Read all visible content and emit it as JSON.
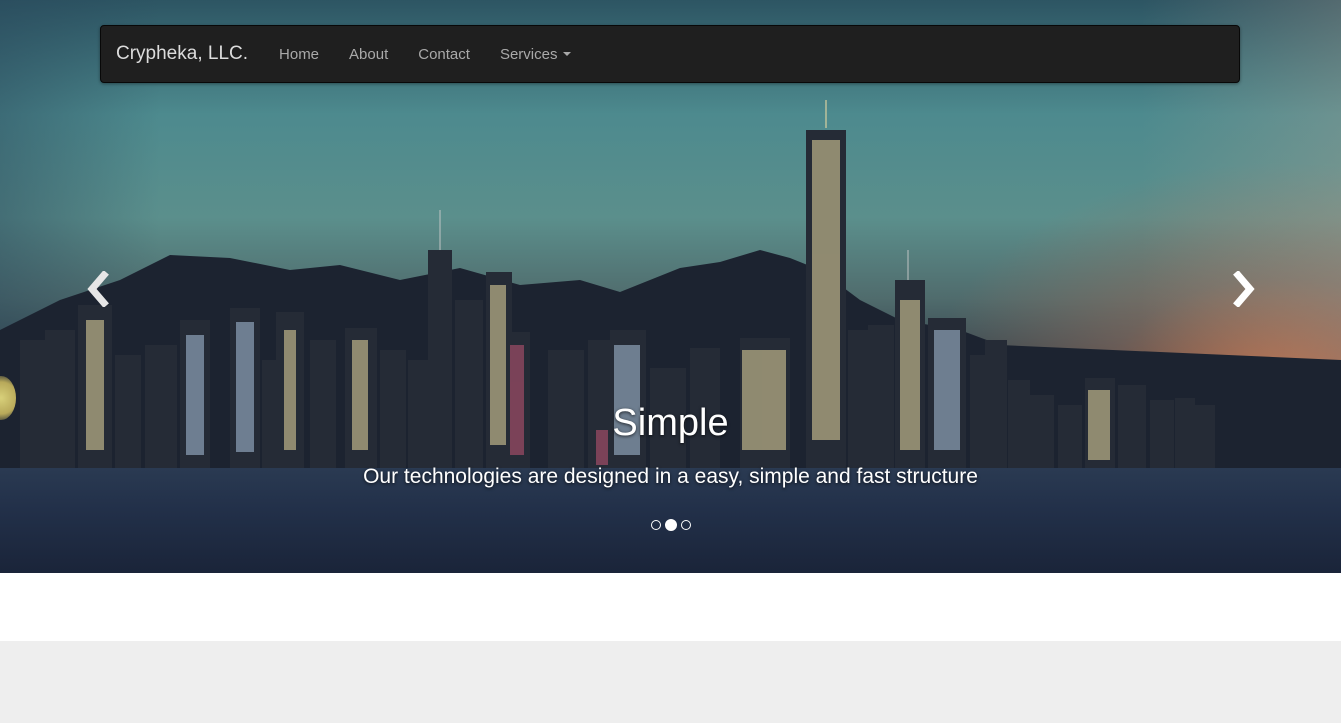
{
  "navbar": {
    "brand": "Crypheka, LLC.",
    "links": [
      {
        "label": "Home"
      },
      {
        "label": "About"
      },
      {
        "label": "Contact"
      },
      {
        "label": "Services",
        "dropdown": true
      }
    ]
  },
  "carousel": {
    "caption_title": "Simple",
    "caption_text": "Our technologies are designed in a easy, simple and fast structure",
    "slide_count": 3,
    "active_index": 1,
    "prev_icon": "chevron-left-icon",
    "next_icon": "chevron-right-icon"
  },
  "colors": {
    "navbar_bg": "#1f1f1f",
    "brand_text": "#dcdcdc",
    "nav_text": "#a9a9a9",
    "gray_section": "#eeeeee"
  }
}
